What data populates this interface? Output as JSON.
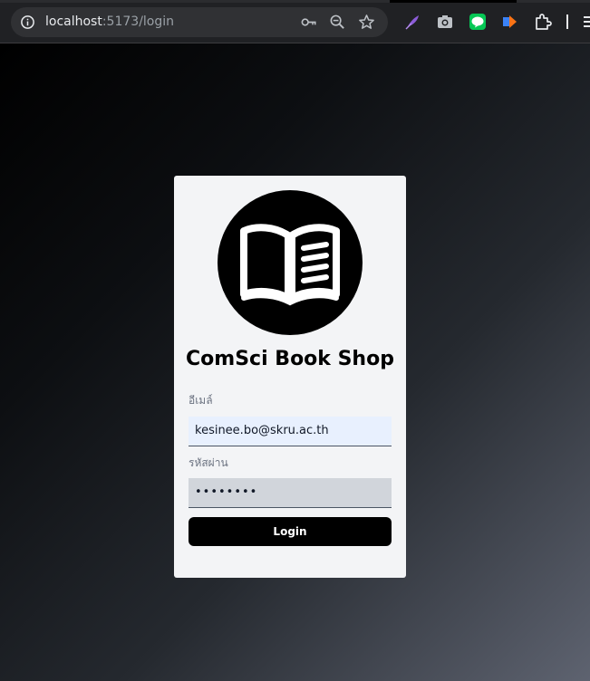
{
  "browser": {
    "url_host": "localhost",
    "url_path": ":5173/login",
    "icons": {
      "site_info": "info-icon",
      "password_key": "key-icon",
      "zoom": "zoom-icon",
      "bookmark": "star-icon",
      "extensions": [
        "feather-extension-icon",
        "camera-extension-icon",
        "line-extension-icon",
        "audio-extension-icon",
        "puzzle-icon"
      ],
      "menu": "menu-icon"
    }
  },
  "login": {
    "logo_icon": "open-book-icon",
    "title": "ComSci Book Shop",
    "email_label": "อีเมล์",
    "email_value": "kesinee.bo@skru.ac.th",
    "password_label": "รหัสผ่าน",
    "password_value": "••••••••",
    "button_label": "Login"
  },
  "colors": {
    "card_background": "#f3f4f6",
    "button_background": "#000000",
    "email_field_background": "#e8f0fe",
    "password_field_background": "#d1d5db"
  }
}
